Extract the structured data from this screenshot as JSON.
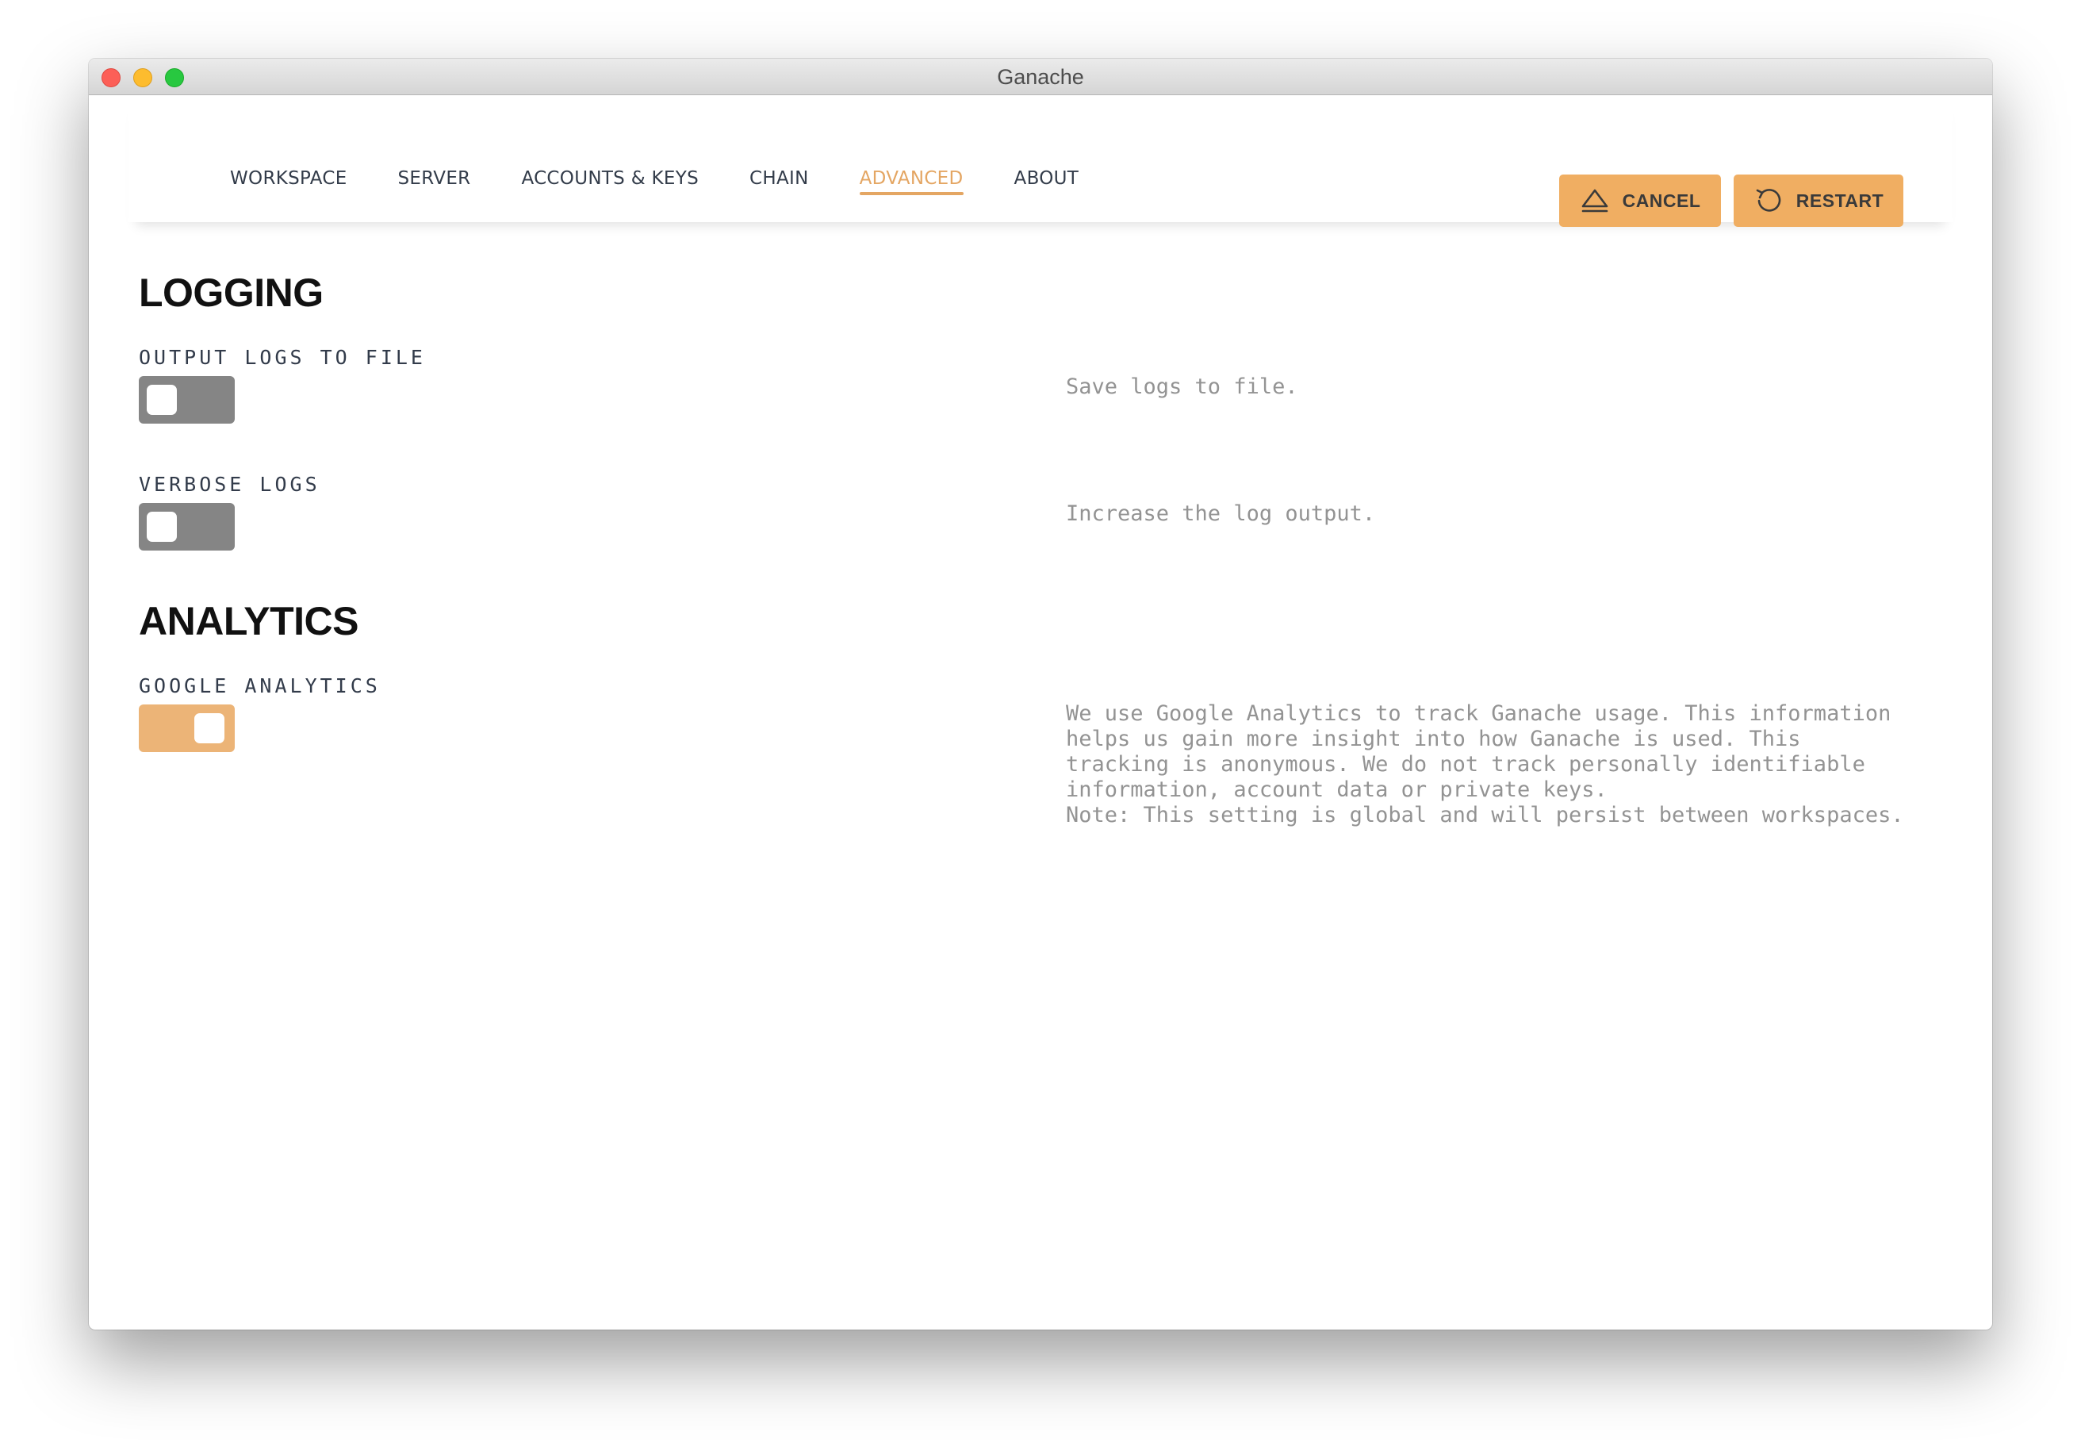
{
  "window": {
    "title": "Ganache"
  },
  "nav": {
    "tabs": [
      {
        "label": "WORKSPACE",
        "active": false
      },
      {
        "label": "SERVER",
        "active": false
      },
      {
        "label": "ACCOUNTS & KEYS",
        "active": false
      },
      {
        "label": "CHAIN",
        "active": false
      },
      {
        "label": "ADVANCED",
        "active": true
      },
      {
        "label": "ABOUT",
        "active": false
      }
    ]
  },
  "actions": {
    "cancel": {
      "label": "CANCEL",
      "icon": "eject-icon"
    },
    "restart": {
      "label": "RESTART",
      "icon": "restart-icon"
    }
  },
  "logging": {
    "title": "LOGGING",
    "output_logs": {
      "label": "OUTPUT LOGS TO FILE",
      "enabled": false,
      "description": "Save logs to file."
    },
    "verbose_logs": {
      "label": "VERBOSE LOGS",
      "enabled": false,
      "description": "Increase the log output."
    }
  },
  "analytics": {
    "title": "ANALYTICS",
    "google_analytics": {
      "label": "GOOGLE ANALYTICS",
      "enabled": true,
      "description": "We use Google Analytics to track Ganache usage. This information\nhelps us gain more insight into how Ganache is used. This\ntracking is anonymous. We do not track personally identifiable\ninformation, account data or private keys.\nNote: This setting is global and will persist between workspaces."
    }
  },
  "colors": {
    "accent": "#f0ae62",
    "toggle_off": "#858585",
    "toggle_on": "#ecb477",
    "active_tab": "#e4a663"
  }
}
